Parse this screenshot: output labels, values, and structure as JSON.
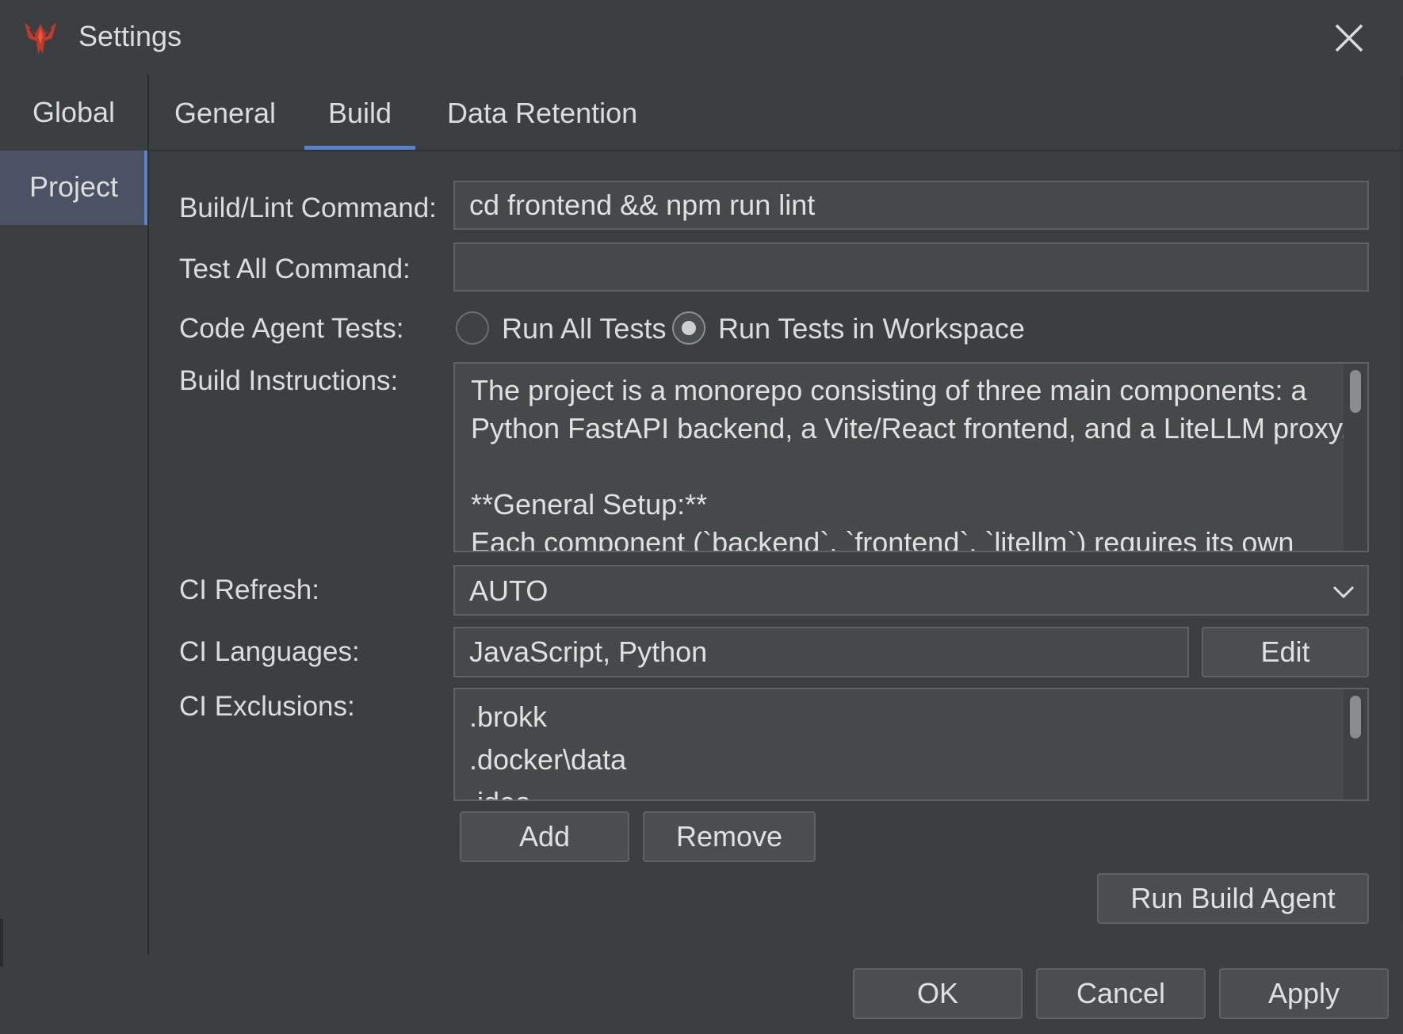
{
  "window": {
    "title": "Settings",
    "logo_icon": "brokk-logo-icon",
    "close_icon": "close-icon"
  },
  "left_nav": {
    "items": [
      {
        "label": "Global",
        "selected": false
      },
      {
        "label": "Project",
        "selected": true
      }
    ]
  },
  "tabs": [
    {
      "label": "General",
      "selected": false
    },
    {
      "label": "Build",
      "selected": true
    },
    {
      "label": "Data Retention",
      "selected": false
    }
  ],
  "form": {
    "build_lint": {
      "label": "Build/Lint Command:",
      "value": "cd frontend && npm run lint"
    },
    "test_all": {
      "label": "Test All Command:",
      "value": ""
    },
    "code_agent_tests": {
      "label": "Code Agent Tests:",
      "options": [
        {
          "label": "Run All Tests",
          "checked": false
        },
        {
          "label": "Run Tests in Workspace",
          "checked": true
        }
      ]
    },
    "build_instructions": {
      "label": "Build Instructions:",
      "lines": [
        "The project is a monorepo consisting of three main components: a",
        "Python FastAPI backend, a Vite/React frontend, and a LiteLLM proxy.",
        "",
        "**General Setup:**",
        "Each component (`backend`, `frontend`, `litellm`) requires its own"
      ]
    },
    "ci_refresh": {
      "label": "CI Refresh:",
      "value": "AUTO"
    },
    "ci_languages": {
      "label": "CI Languages:",
      "value": "JavaScript, Python",
      "edit_label": "Edit"
    },
    "ci_exclusions": {
      "label": "CI Exclusions:",
      "items": [
        ".brokk",
        ".docker\\data",
        ".idea"
      ],
      "add_label": "Add",
      "remove_label": "Remove"
    },
    "run_build_agent_label": "Run Build Agent"
  },
  "footer": {
    "ok_label": "OK",
    "cancel_label": "Cancel",
    "apply_label": "Apply"
  },
  "colors": {
    "background": "#3c3f41",
    "field": "#45494a",
    "accent": "#5b82c9",
    "selected_nav": "#4a5263",
    "logo": "#c0392b"
  }
}
